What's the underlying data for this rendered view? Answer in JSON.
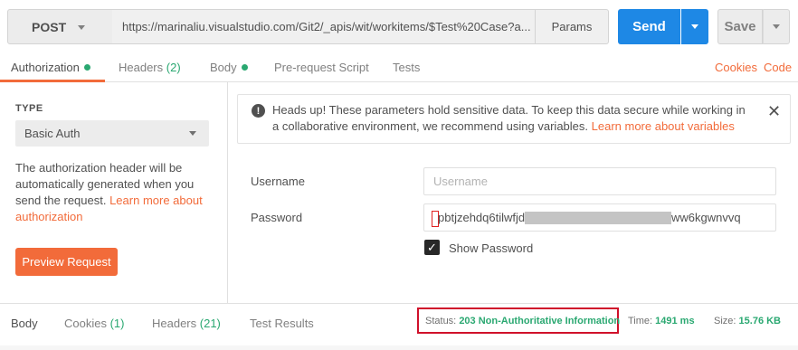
{
  "request": {
    "method": "POST",
    "url": "https://marinaliu.visualstudio.com/Git2/_apis/wit/workitems/$Test%20Case?a...",
    "params_label": "Params",
    "send_label": "Send",
    "save_label": "Save"
  },
  "tabs": [
    {
      "label": "Authorization",
      "count": "",
      "dot": true
    },
    {
      "label": "Headers",
      "count": "(2)",
      "dot": false
    },
    {
      "label": "Body",
      "count": "",
      "dot": true
    },
    {
      "label": "Pre-request Script",
      "count": "",
      "dot": false
    },
    {
      "label": "Tests",
      "count": "",
      "dot": false
    }
  ],
  "tab_links": {
    "cookies": "Cookies",
    "code": "Code"
  },
  "auth": {
    "type_label": "TYPE",
    "type_value": "Basic Auth",
    "desc_text": "The authorization header will be automatically generated when you send the request. ",
    "desc_link": "Learn more about authorization",
    "preview_label": "Preview Request"
  },
  "alert": {
    "text": "Heads up! These parameters hold sensitive data. To keep this data secure while working in a collaborative environment, we recommend using variables. ",
    "link": "Learn more about variables",
    "icon_glyph": "!",
    "close_glyph": "✕"
  },
  "form": {
    "username_label": "Username",
    "username_placeholder": "Username",
    "password_label": "Password",
    "password_start": "pbtjzehdq6tilwfjdl",
    "password_end": "ww6kgwnvvq",
    "show_password_label": "Show Password",
    "check_glyph": "✓"
  },
  "response": {
    "tabs": [
      {
        "label": "Body",
        "count": ""
      },
      {
        "label": "Cookies",
        "count": "(1)"
      },
      {
        "label": "Headers",
        "count": "(21)"
      },
      {
        "label": "Test Results",
        "count": ""
      }
    ],
    "status_label": "Status:",
    "status_value": "203 Non-Authoritative Information",
    "time_label": "Time:",
    "time_value": "1491 ms",
    "size_label": "Size:",
    "size_value": "15.76 KB"
  },
  "colors": {
    "accent": "#f26b3a",
    "send": "#1e88e5",
    "success": "#2aa871",
    "highlight": "#d0112b"
  }
}
